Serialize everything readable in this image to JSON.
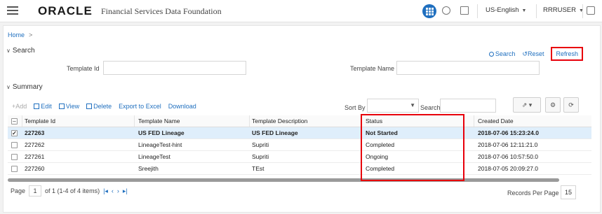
{
  "header": {
    "logo": "ORACLE",
    "product": "Financial Services Data Foundation",
    "language": "US-English",
    "user": "RRRUSER"
  },
  "breadcrumb": {
    "home": "Home",
    "separator": ">"
  },
  "search": {
    "title": "Search",
    "search_link": "Search",
    "reset_link": "Reset",
    "refresh_link": "Refresh",
    "template_id_label": "Template Id",
    "template_id_value": "",
    "template_name_label": "Template Name",
    "template_name_value": ""
  },
  "summary": {
    "title": "Summary",
    "toolbar": {
      "add": "Add",
      "edit": "Edit",
      "view": "View",
      "delete": "Delete",
      "export": "Export to Excel",
      "download": "Download"
    },
    "sort_by_label": "Sort By",
    "sort_by_value": "",
    "search_label": "Search",
    "search_value": ""
  },
  "table": {
    "headers": [
      "Template Id",
      "Template Name",
      "Template Description",
      "Status",
      "Created Date"
    ],
    "rows": [
      {
        "id": "227263",
        "name": "US FED Lineage",
        "desc": "US FED Lineage",
        "status": "Not Started",
        "created": "2018-07-06 15:23:24.0"
      },
      {
        "id": "227262",
        "name": "LineageTest-hint",
        "desc": "Supriti",
        "status": "Completed",
        "created": "2018-07-06 12:11:21.0"
      },
      {
        "id": "227261",
        "name": "LineageTest",
        "desc": "Supriti",
        "status": "Ongoing",
        "created": "2018-07-06 10:57:50.0"
      },
      {
        "id": "227260",
        "name": "Sreejith",
        "desc": "TEst",
        "status": "Completed",
        "created": "2018-07-05 20:09:27.0"
      }
    ]
  },
  "pager": {
    "page_label": "Page",
    "page_value": "1",
    "of_text": "of 1 (1-4 of 4 items)",
    "records_per_page_label": "Records Per Page",
    "records_per_page_value": "15"
  },
  "colors": {
    "accent": "#1f6fbf",
    "highlight": "#e8000b",
    "selected_row": "#dfeefb"
  }
}
